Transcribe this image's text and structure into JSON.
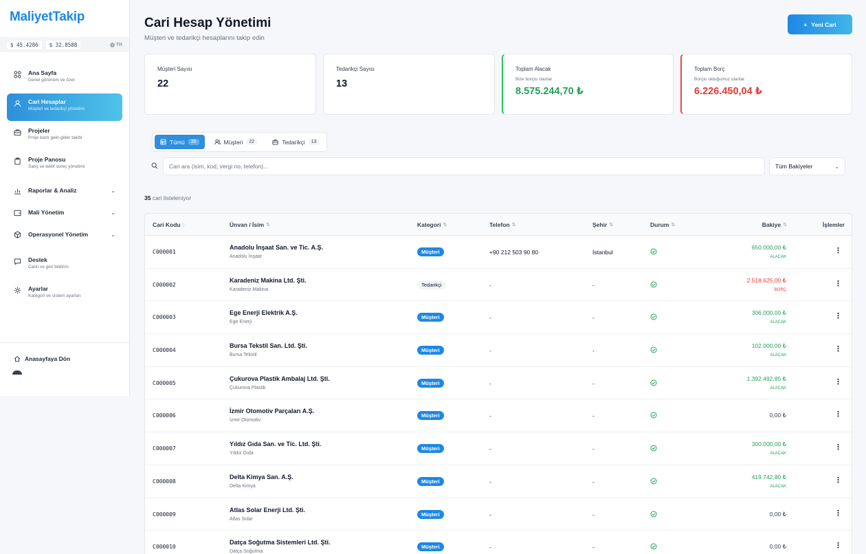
{
  "app": {
    "name": "MaliyetTakip"
  },
  "rates": {
    "usd": "$ 45.4286",
    "other": "$ 32.8588",
    "lang": "TR"
  },
  "nav": {
    "home": {
      "label": "Ana Sayfa",
      "sub": "Genel görünüm ve özet"
    },
    "accounts": {
      "label": "Cari Hesaplar",
      "sub": "Müşteri ve tedarikçi yönetimi"
    },
    "projects": {
      "label": "Projeler",
      "sub": "Proje bazlı gelir-gider takibi"
    },
    "board": {
      "label": "Proje Panosu",
      "sub": "Satış ve teklif süreç yönetimi"
    },
    "reports": {
      "label": "Raporlar & Analiz"
    },
    "finance": {
      "label": "Mali Yönetim"
    },
    "operations": {
      "label": "Operasyonel Yönetim"
    },
    "support": {
      "label": "Destek",
      "sub": "Canlı ve geri bildirim"
    },
    "settings": {
      "label": "Ayarlar",
      "sub": "Kategori ve sistem ayarları"
    },
    "back_home": "Anasayfaya Dön"
  },
  "header": {
    "title": "Cari Hesap Yönetimi",
    "subtitle": "Müşteri ve tedarikçi hesaplarını takip edin",
    "new_button": "Yeni Cari"
  },
  "stats": {
    "customers": {
      "label": "Müşteri Sayısı",
      "value": "22"
    },
    "suppliers": {
      "label": "Tedarikçi Sayısı",
      "value": "13"
    },
    "receivable": {
      "label": "Toplam Alacak",
      "sub": "Bize borçlu olanlar",
      "value": "8.575.244,70 ₺"
    },
    "debt": {
      "label": "Toplam Borç",
      "sub": "Borçlu olduğumuz olanlar",
      "value": "6.226.450,04 ₺"
    }
  },
  "tabs": [
    {
      "label": "Tümü",
      "count": "35"
    },
    {
      "label": "Müşteri",
      "count": "22"
    },
    {
      "label": "Tedarikçi",
      "count": "13"
    }
  ],
  "search": {
    "placeholder": "Cari ara (isim, kod, vergi no, telefon)...",
    "filter": "Tüm Bakiyeler"
  },
  "list": {
    "count": "35",
    "count_text": "cari listeleniyor"
  },
  "table": {
    "columns": [
      "Cari Kodu",
      "Ünvan / İsim",
      "Kategori",
      "Telefon",
      "Şehir",
      "Durum",
      "Bakiye",
      "İşlemler"
    ],
    "rows": [
      {
        "code": "C000001",
        "name": "Anadolu İnşaat San. ve Tic. A.Ş.",
        "sub": "Anadolu İnşaat",
        "cat": "Müşteri",
        "phone": "+90 212 503 90 80",
        "city": "İstanbul",
        "balance": "650.000,00 ₺",
        "btype": "ALACAK"
      },
      {
        "code": "C000002",
        "name": "Karadeniz Makina Ltd. Şti.",
        "sub": "Karadeniz Makina",
        "cat": "Tedarikçi",
        "phone": "-",
        "city": "-",
        "balance": "2.518.625,00 ₺",
        "btype": "BORÇ"
      },
      {
        "code": "C000003",
        "name": "Ege Enerji Elektrik A.Ş.",
        "sub": "Ege Enerji",
        "cat": "Müşteri",
        "phone": "-",
        "city": "-",
        "balance": "306.000,00 ₺",
        "btype": "ALACAK"
      },
      {
        "code": "C000004",
        "name": "Bursa Tekstil San. Ltd. Şti.",
        "sub": "Bursa Tekstil",
        "cat": "Müşteri",
        "phone": "-",
        "city": "-",
        "balance": "102.000,00 ₺",
        "btype": "ALACAK"
      },
      {
        "code": "C000005",
        "name": "Çukurova Plastik Ambalaj Ltd. Şti.",
        "sub": "Çukurova Plastik",
        "cat": "Müşteri",
        "phone": "-",
        "city": "-",
        "balance": "1.392.492,85 ₺",
        "btype": "ALACAK"
      },
      {
        "code": "C000006",
        "name": "İzmir Otomotiv Parçaları A.Ş.",
        "sub": "İzmir Otomotiv",
        "cat": "Müşteri",
        "phone": "-",
        "city": "-",
        "balance": "0,00 ₺",
        "btype": ""
      },
      {
        "code": "C000007",
        "name": "Yıldız Gıda San. ve Tic. Ltd. Şti.",
        "sub": "Yıldız Gıda",
        "cat": "Müşteri",
        "phone": "-",
        "city": "-",
        "balance": "300.000,00 ₺",
        "btype": "ALACAK"
      },
      {
        "code": "C000008",
        "name": "Delta Kimya San. A.Ş.",
        "sub": "Delta Kimya",
        "cat": "Müşteri",
        "phone": "-",
        "city": "-",
        "balance": "419.742,80 ₺",
        "btype": "ALACAK"
      },
      {
        "code": "C000009",
        "name": "Atlas Solar Enerji Ltd. Şti.",
        "sub": "Atlas Solar",
        "cat": "Müşteri",
        "phone": "-",
        "city": "-",
        "balance": "0,00 ₺",
        "btype": ""
      },
      {
        "code": "C000010",
        "name": "Datça Soğutma Sistemleri Ltd. Şti.",
        "sub": "Datça Soğutma",
        "cat": "Müşteri",
        "phone": "-",
        "city": "-",
        "balance": "0,00 ₺",
        "btype": ""
      }
    ]
  },
  "colors": {
    "accent": "#1e88e5",
    "positive": "#22a05a",
    "negative": "#e53935"
  }
}
